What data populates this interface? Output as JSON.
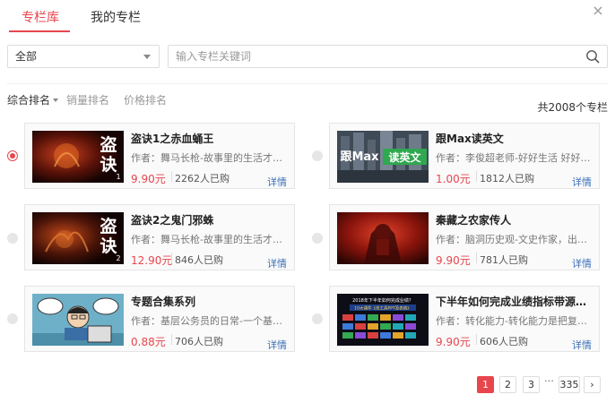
{
  "tabs": [
    {
      "label": "专栏库",
      "active": true
    },
    {
      "label": "我的专栏",
      "active": false
    }
  ],
  "close_icon": "×",
  "filter": {
    "selected": "全部"
  },
  "search": {
    "placeholder": "输入专栏关键词",
    "value": ""
  },
  "sort_options": [
    {
      "label": "综合排名",
      "active": true
    },
    {
      "label": "销量排名",
      "active": false
    },
    {
      "label": "价格排名",
      "active": false
    }
  ],
  "total": "共2008个专栏",
  "columns": [
    {
      "title": "盗诀1之赤血蛹王",
      "author": "作者：舞马长枪-故事里的生活才是生活，最好的故事就在天涯",
      "price": "9.90元",
      "sold": "2262人已购",
      "detail": "详情",
      "thumb": {
        "kind": "daojue",
        "big": "盗",
        "big2": "诀",
        "num": "1"
      },
      "selected": true
    },
    {
      "title": "跟Max读英文",
      "author": "作者：李俊超老师-好好生活 好好学习 天天向上",
      "price": "1.00元",
      "sold": "1812人已购",
      "detail": "详情",
      "thumb": {
        "kind": "max",
        "text1": "跟Max",
        "text2": "读英文"
      },
      "selected": false
    },
    {
      "title": "盗诀2之鬼门邪蛛",
      "author": "作者：舞马长枪-故事里的生活才是生活，最好的故事就在天涯",
      "price": "12.90元",
      "sold": "846人已购",
      "detail": "详情",
      "thumb": {
        "kind": "daojue",
        "big": "盗",
        "big2": "诀",
        "num": "2"
      },
      "selected": false
    },
    {
      "title": "秦藏之农家传人",
      "author": "作者：脑洞历史观-文史作家，出版有多部作品",
      "price": "9.90元",
      "sold": "781人已购",
      "detail": "详情",
      "thumb": {
        "kind": "qin"
      },
      "selected": false
    },
    {
      "title": "专题合集系列",
      "author": "作者：基层公务员的日常-一个基层公务员的职场心得",
      "price": "0.88元",
      "sold": "706人已购",
      "detail": "详情",
      "thumb": {
        "kind": "cartoon"
      },
      "selected": false
    },
    {
      "title": "下半年如何完成业绩指标带源管理",
      "author": "作者：转化能力-转化能力是把复杂转化为简单",
      "price": "9.90元",
      "sold": "606人已购",
      "detail": "详情",
      "thumb": {
        "kind": "ppt",
        "heading": "2018年下半年如何完成业绩？",
        "sub": "10大课件《含工具PPT及表格》"
      },
      "selected": false
    }
  ],
  "pagination": {
    "pages": [
      "1",
      "2",
      "3"
    ],
    "ellipsis": "…",
    "last": "335",
    "next": "›",
    "current": "1"
  },
  "colors": {
    "accent": "#e8464d",
    "link": "#3b6fb6",
    "border": "#e5e5e5"
  }
}
